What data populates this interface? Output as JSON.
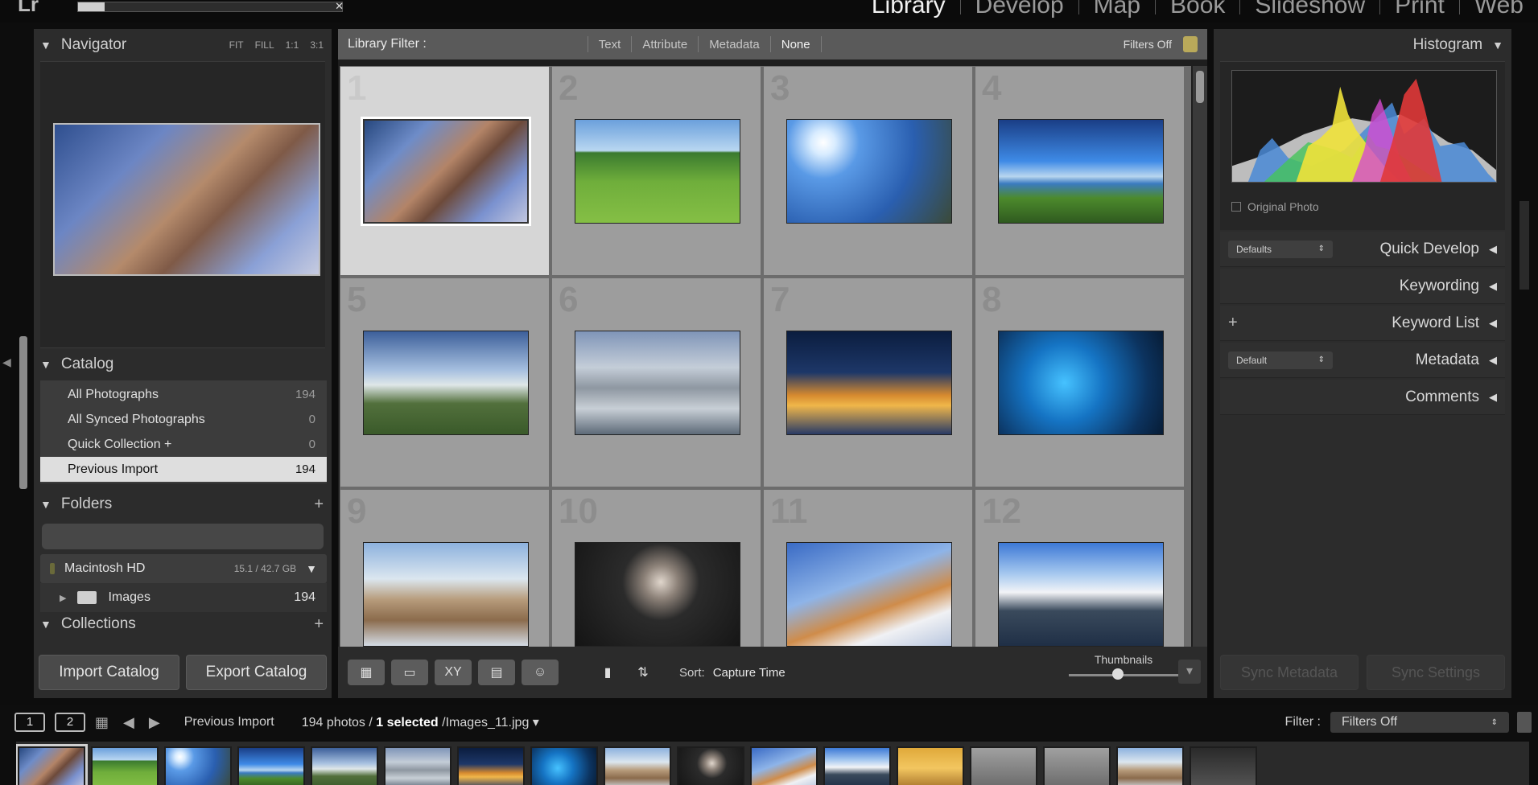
{
  "app": {
    "logo": "Lr"
  },
  "modules": [
    "Library",
    "Develop",
    "Map",
    "Book",
    "Slideshow",
    "Print",
    "Web"
  ],
  "import_progress": 0.1,
  "left_panel": {
    "navigator": {
      "title": "Navigator",
      "options": [
        "FIT",
        "FILL",
        "1:1",
        "3:1"
      ]
    },
    "catalog": {
      "title": "Catalog",
      "items": [
        {
          "label": "All Photographs",
          "count": "194"
        },
        {
          "label": "All Synced Photographs",
          "count": "0"
        },
        {
          "label": "Quick Collection +",
          "count": "0"
        },
        {
          "label": "Previous Import",
          "count": "194"
        }
      ]
    },
    "folders": {
      "title": "Folders",
      "volume": {
        "name": "Macintosh HD",
        "size": "15.1 / 42.7 GB"
      },
      "items": [
        {
          "label": "Images",
          "count": "194"
        }
      ]
    },
    "collections": {
      "title": "Collections"
    },
    "buttons": {
      "import": "Import Catalog",
      "export": "Export Catalog"
    }
  },
  "center": {
    "filter": {
      "label": "Library Filter :",
      "tabs": [
        "Text",
        "Attribute",
        "Metadata",
        "None"
      ],
      "status": "Filters Off"
    },
    "cells": [
      {
        "num": "1",
        "theme": "t-anime"
      },
      {
        "num": "2",
        "theme": "t-barn"
      },
      {
        "num": "3",
        "theme": "t-sun"
      },
      {
        "num": "4",
        "theme": "t-lake"
      },
      {
        "num": "5",
        "theme": "t-tree"
      },
      {
        "num": "6",
        "theme": "t-city"
      },
      {
        "num": "7",
        "theme": "t-night"
      },
      {
        "num": "8",
        "theme": "t-blue"
      },
      {
        "num": "9",
        "theme": "t-coast"
      },
      {
        "num": "10",
        "theme": "t-woman"
      },
      {
        "num": "11",
        "theme": "t-tiger"
      },
      {
        "num": "12",
        "theme": "t-mount"
      }
    ],
    "toolbar": {
      "sort_label": "Sort:",
      "sort_value": "Capture Time",
      "thumbnails_label": "Thumbnails",
      "thumbnail_size": 0.45
    }
  },
  "right_panel": {
    "histogram": {
      "title": "Histogram",
      "original_photo_label": "Original Photo"
    },
    "sections": [
      {
        "title": "Quick Develop",
        "preset": "Defaults"
      },
      {
        "title": "Keywording"
      },
      {
        "title": "Keyword List",
        "plus": "+"
      },
      {
        "title": "Metadata",
        "preset": "Default"
      },
      {
        "title": "Comments"
      }
    ],
    "buttons": {
      "sync_metadata": "Sync Metadata",
      "sync_settings": "Sync Settings"
    }
  },
  "filmstrip": {
    "screens": [
      "1",
      "2"
    ],
    "source": "Previous Import",
    "count": "194 photos /",
    "selected": "1 selected",
    "file": "/Images_11.jpg",
    "filter_label": "Filter :",
    "filter_value": "Filters Off",
    "thumbs": [
      "t-anime",
      "t-barn",
      "t-sun",
      "t-lake",
      "t-tree",
      "t-city",
      "t-night",
      "t-blue",
      "t-coast",
      "t-woman",
      "t-tiger",
      "t-mount",
      "t-yellow",
      "t-gray",
      "t-gray",
      "t-coast",
      "t-dark"
    ]
  }
}
